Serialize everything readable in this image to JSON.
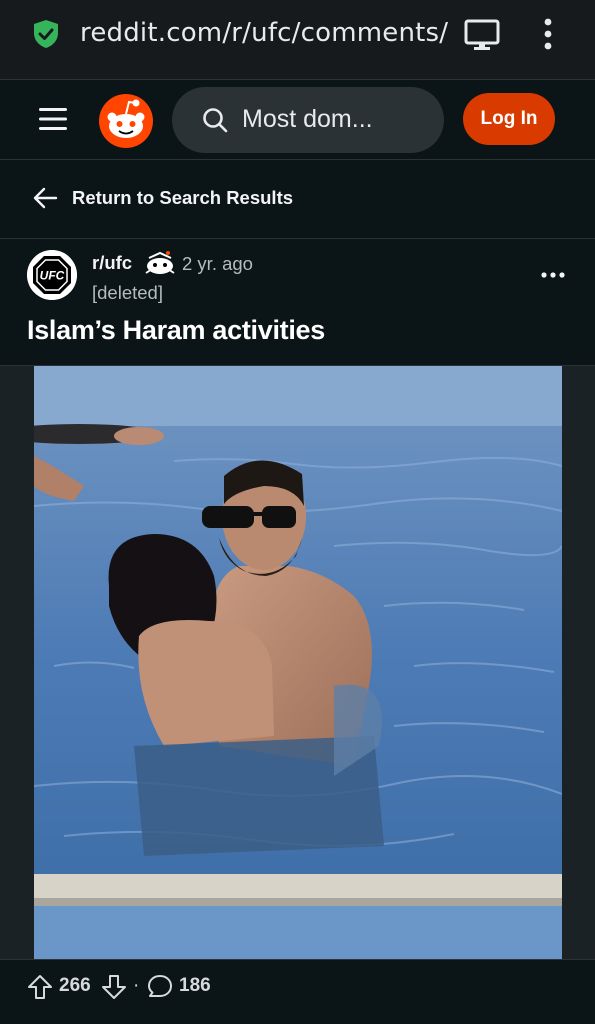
{
  "browser": {
    "url": "reddit.com/r/ufc/comments/",
    "icons": [
      "shield-check-icon",
      "desktop-icon",
      "kebab-menu-icon"
    ]
  },
  "header": {
    "search_text": "Most dom...",
    "login_label": "Log In",
    "accent": "#d93a00",
    "icons": [
      "hamburger-icon",
      "reddit-logo-icon",
      "search-icon"
    ]
  },
  "nav": {
    "back_label": "Return to Search Results"
  },
  "post": {
    "subreddit": "r/ufc",
    "age": "2 yr. ago",
    "author": "[deleted]",
    "title": "Islam’s Haram activities",
    "avatar_text": "UFC",
    "score": "266",
    "separator": "·",
    "comments": "186"
  }
}
